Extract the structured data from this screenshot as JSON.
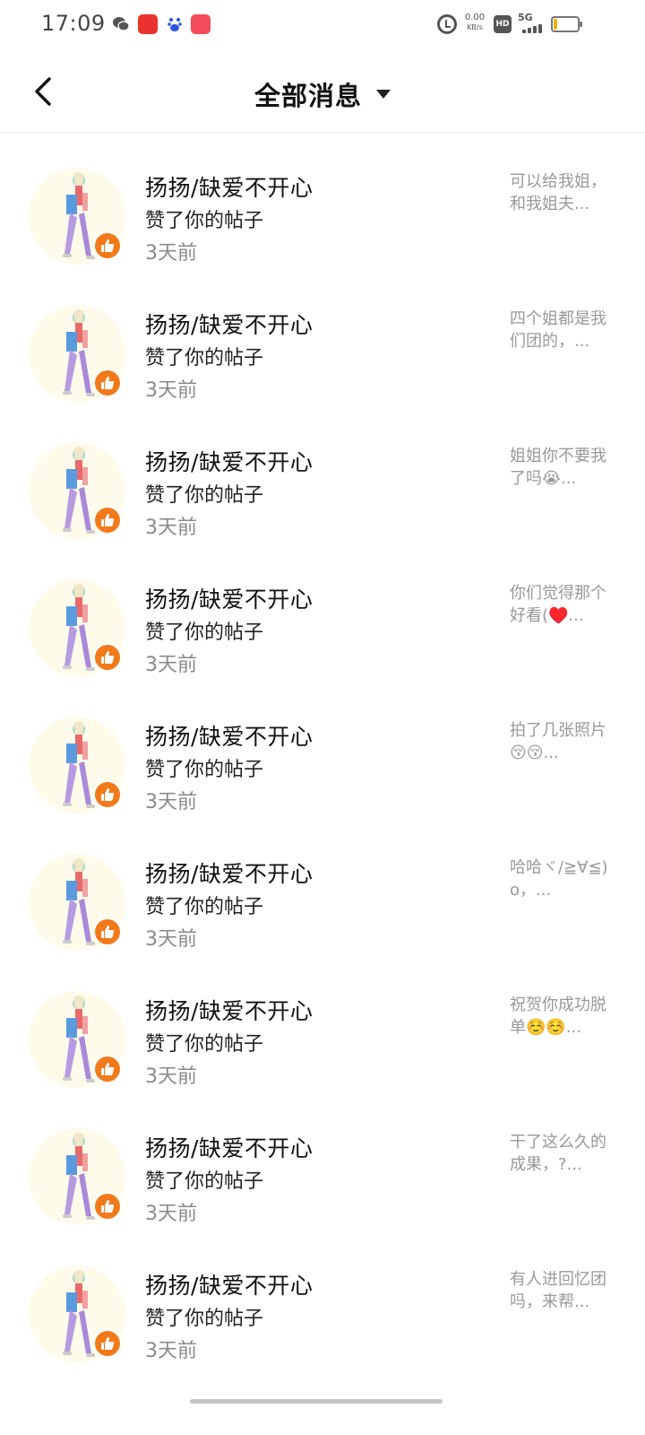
{
  "status_bar": {
    "time": "17:09",
    "net_speed_value": "0.00",
    "net_speed_unit": "KB/s",
    "hd_label": "HD",
    "network_label": "5G",
    "battery_level": 0.15,
    "app_icons": [
      "wechat-icon",
      "app-red-icon",
      "baidu-icon",
      "app-pink-icon"
    ]
  },
  "header": {
    "title": "全部消息"
  },
  "colors": {
    "accent": "#f27a1a",
    "text_primary": "#111111",
    "text_secondary": "#8a8a8a",
    "avatar_bg": "#fefbea"
  },
  "notifications": [
    {
      "name": "扬扬/缺爱不开心",
      "action": "赞了你的帖子",
      "time": "3天前",
      "preview": "可以给我姐，和我姐夫..."
    },
    {
      "name": "扬扬/缺爱不开心",
      "action": "赞了你的帖子",
      "time": "3天前",
      "preview": "四个姐都是我们团的，..."
    },
    {
      "name": "扬扬/缺爱不开心",
      "action": "赞了你的帖子",
      "time": "3天前",
      "preview": "姐姐你不要我了吗😭..."
    },
    {
      "name": "扬扬/缺爱不开心",
      "action": "赞了你的帖子",
      "time": "3天前",
      "preview": "你们觉得那个好看(♥️..."
    },
    {
      "name": "扬扬/缺爱不开心",
      "action": "赞了你的帖子",
      "time": "3天前",
      "preview": "拍了几张照片😚😚..."
    },
    {
      "name": "扬扬/缺爱不开心",
      "action": "赞了你的帖子",
      "time": "3天前",
      "preview": "哈哈ヾ/≧∀≦)o，..."
    },
    {
      "name": "扬扬/缺爱不开心",
      "action": "赞了你的帖子",
      "time": "3天前",
      "preview": "祝贺你成功脱单☺️☺️..."
    },
    {
      "name": "扬扬/缺爱不开心",
      "action": "赞了你的帖子",
      "time": "3天前",
      "preview": "干了这么久的成果，?..."
    },
    {
      "name": "扬扬/缺爱不开心",
      "action": "赞了你的帖子",
      "time": "3天前",
      "preview": "有人进回忆团吗，来帮..."
    }
  ]
}
